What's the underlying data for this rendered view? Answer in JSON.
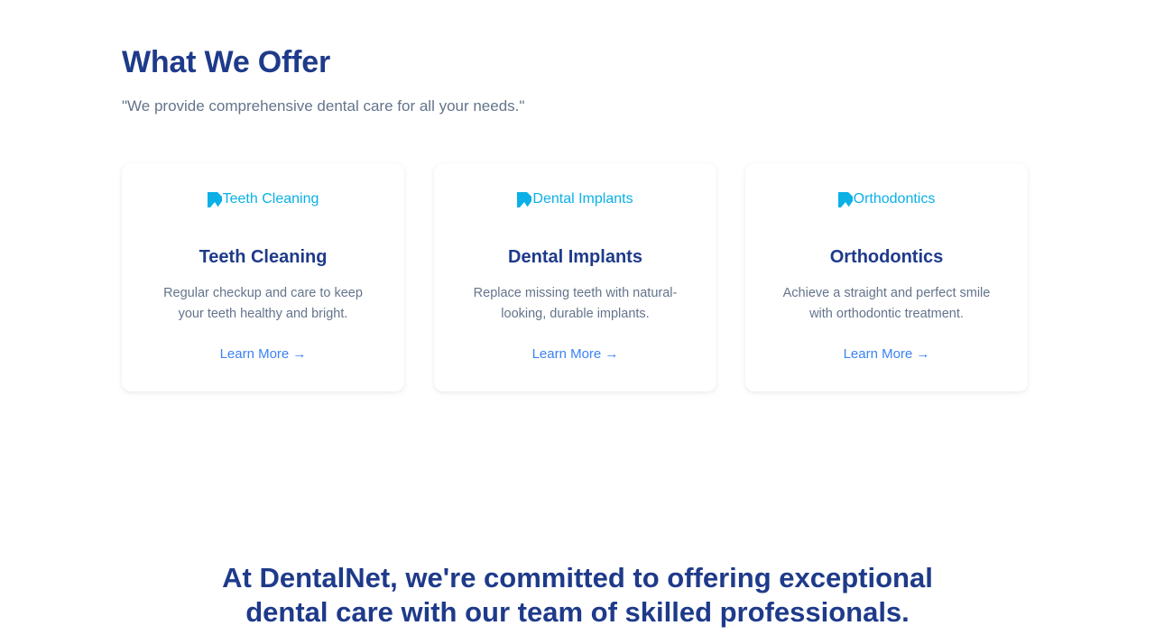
{
  "offer": {
    "heading": "What We Offer",
    "subtitle": "\"We provide comprehensive dental care for all your needs.\"",
    "cards": [
      {
        "image_alt": "Teeth Cleaning",
        "title": "Teeth Cleaning",
        "description": "Regular checkup and care to keep your teeth healthy and bright.",
        "link": "Learn More →"
      },
      {
        "image_alt": "Dental Implants",
        "title": "Dental Implants",
        "description": "Replace missing teeth with natural-looking, durable implants.",
        "link": "Learn More →"
      },
      {
        "image_alt": "Orthodontics",
        "title": "Orthodontics",
        "description": "Achieve a straight and perfect smile with orthodontic treatment.",
        "link": "Learn More →"
      }
    ]
  },
  "mission": {
    "line1": "At DentalNet, we're committed to offering exceptional",
    "line2": "dental care with our team of skilled professionals."
  },
  "icons": {
    "broken_image": "broken-image-icon"
  },
  "colors": {
    "heading": "#1e3a8a",
    "muted_text": "#64748b",
    "link": "#3b82f6",
    "image_alt": "#0ab0e6"
  }
}
